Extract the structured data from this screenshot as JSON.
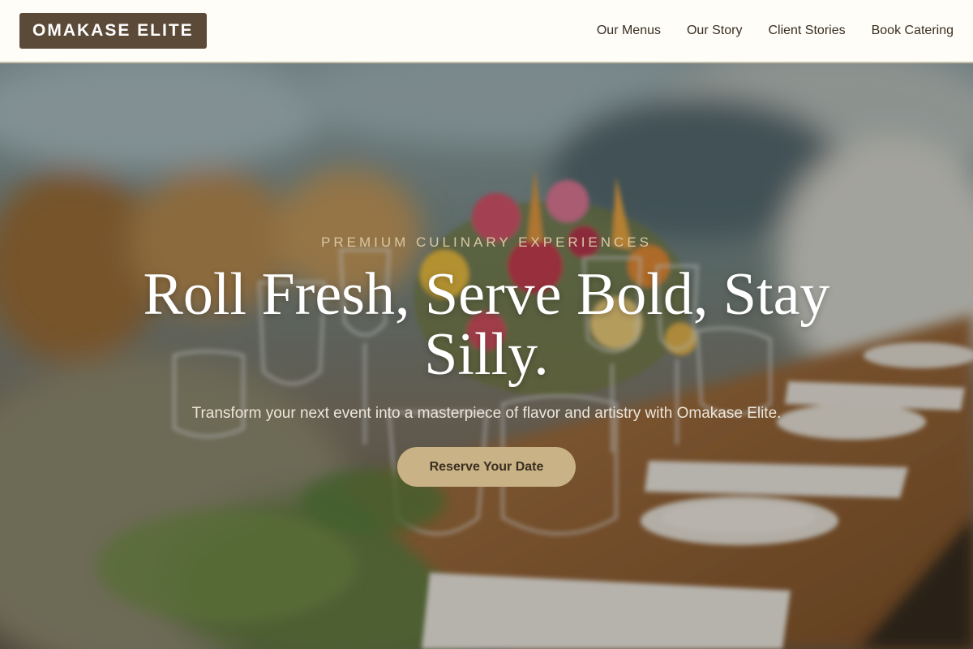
{
  "brand": {
    "name": "OMAKASE ELITE"
  },
  "nav": {
    "items": [
      {
        "label": "Our Menus"
      },
      {
        "label": "Our Story"
      },
      {
        "label": "Client Stories"
      },
      {
        "label": "Book Catering"
      }
    ]
  },
  "hero": {
    "eyebrow": "PREMIUM CULINARY EXPERIENCES",
    "headline": "Roll Fresh, Serve Bold, Stay Silly.",
    "subtext": "Transform your next event into a masterpiece of flavor and artistry with Omakase Elite.",
    "cta_label": "Reserve Your Date",
    "background_image": "banquet-table-photo"
  },
  "colors": {
    "header_bg": "#fefdf8",
    "logo_bg": "#5c4a38",
    "accent_gold": "#c9b285",
    "eyebrow_text": "#d8c8a4",
    "nav_text": "#3a2e22"
  }
}
